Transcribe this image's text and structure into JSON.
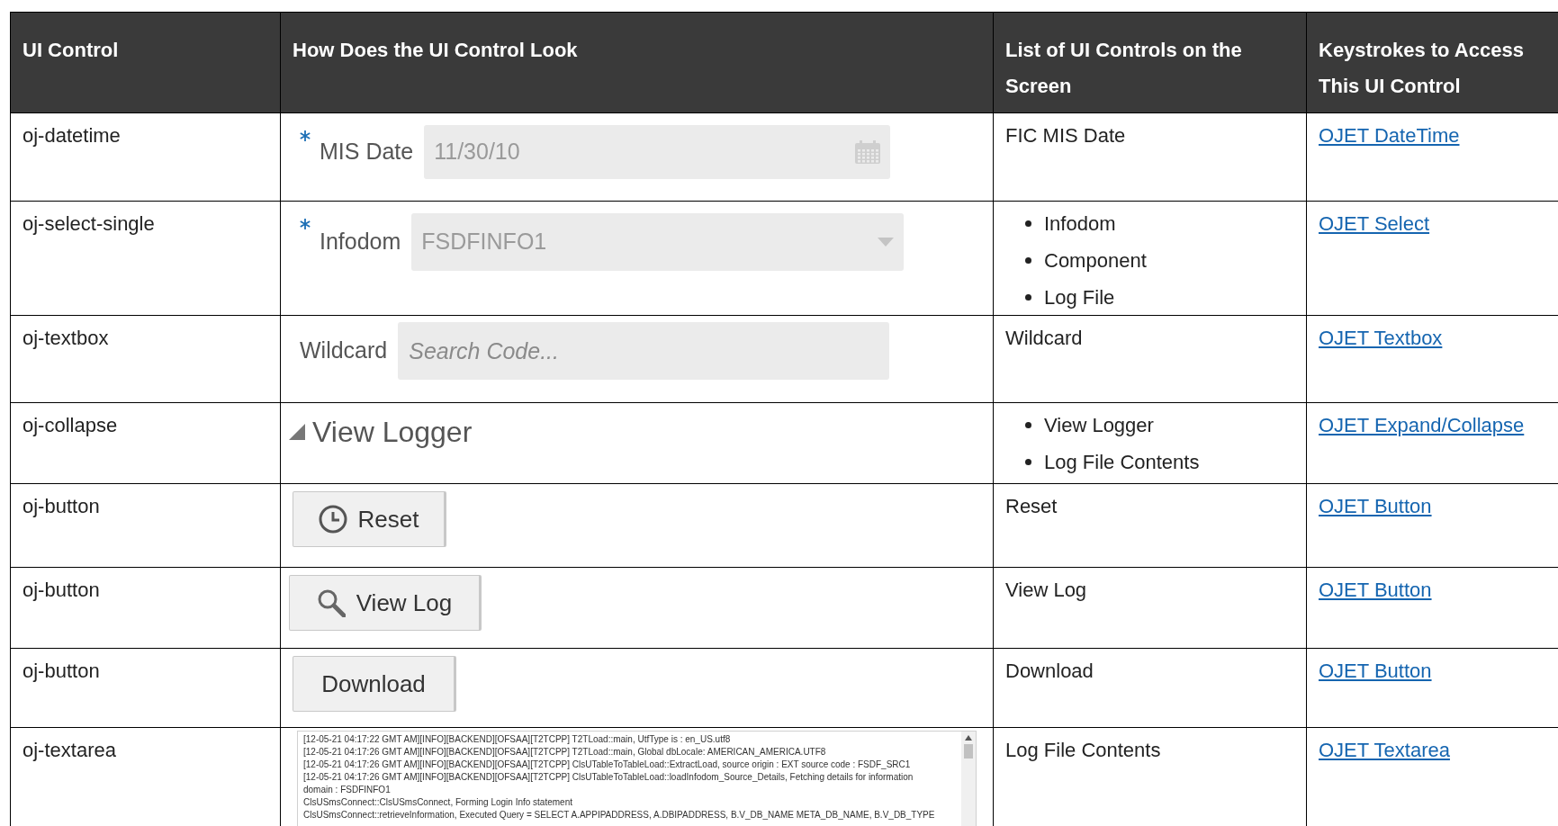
{
  "table": {
    "columns": [
      "UI Control",
      "How Does the UI Control Look",
      "List of UI Controls on the Screen",
      "Keystrokes to Access This UI Control"
    ],
    "rows": [
      {
        "control": "oj-datetime",
        "preview": {
          "kind": "datetime",
          "required": true,
          "label": "MIS Date",
          "value": "11/30/10"
        },
        "screen_controls": [
          "FIC MIS Date"
        ],
        "link": "OJET DateTime"
      },
      {
        "control": "oj-select-single",
        "preview": {
          "kind": "select",
          "required": true,
          "label": "Infodom",
          "value": "FSDFINFO1"
        },
        "screen_controls": [
          "Infodom",
          "Component",
          "Log File"
        ],
        "link": "OJET Select"
      },
      {
        "control": "oj-textbox",
        "preview": {
          "kind": "textbox",
          "required": false,
          "label": "Wildcard",
          "placeholder": "Search Code..."
        },
        "screen_controls": [
          "Wildcard"
        ],
        "link": "OJET Textbox"
      },
      {
        "control": "oj-collapse",
        "preview": {
          "kind": "collapse",
          "expanded": true,
          "label": "View Logger"
        },
        "screen_controls": [
          "View Logger",
          "Log File Contents"
        ],
        "link": "OJET Expand/Collapse"
      },
      {
        "control": "oj-button",
        "preview": {
          "kind": "clockbutton",
          "label": "Reset"
        },
        "screen_controls": [
          "Reset"
        ],
        "link": "OJET Button"
      },
      {
        "control": "oj-button",
        "preview": {
          "kind": "searchbutton",
          "label": "View Log"
        },
        "screen_controls": [
          "View Log"
        ],
        "link": "OJET Button"
      },
      {
        "control": "oj-button",
        "preview": {
          "kind": "button",
          "label": "Download"
        },
        "screen_controls": [
          "Download"
        ],
        "link": "OJET Button"
      },
      {
        "control": "oj-textarea",
        "preview": {
          "kind": "textarea",
          "lines": [
            "[12-05-21 04:17:22 GMT AM][INFO][BACKEND][OFSAA][T2TCPP] T2TLoad::main, UtfType is : en_US.utf8",
            "[12-05-21 04:17:26 GMT AM][INFO][BACKEND][OFSAA][T2TCPP] T2TLoad::main, Global dbLocale: AMERICAN_AMERICA.UTF8",
            "[12-05-21 04:17:26 GMT AM][INFO][BACKEND][OFSAA][T2TCPP] ClsUTableToTableLoad::ExtractLoad, source origin : EXT source code : FSDF_SRC1",
            "[12-05-21 04:17:26 GMT AM][INFO][BACKEND][OFSAA][T2TCPP] ClsUTableToTableLoad::loadInfodom_Source_Details, Fetching details for information",
            "domain : FSDFINFO1",
            "ClsUSmsConnect::ClsUSmsConnect, Forming Login Info statement",
            "ClsUSmsConnect::retrieveInformation, Executed Query = SELECT A.APPIPADDRESS, A.DBIPADDRESS, B.V_DB_NAME META_DB_NAME, B.V_DB_TYPE"
          ]
        },
        "screen_controls": [
          "Log File Contents"
        ],
        "link": "OJET Textarea"
      }
    ]
  }
}
